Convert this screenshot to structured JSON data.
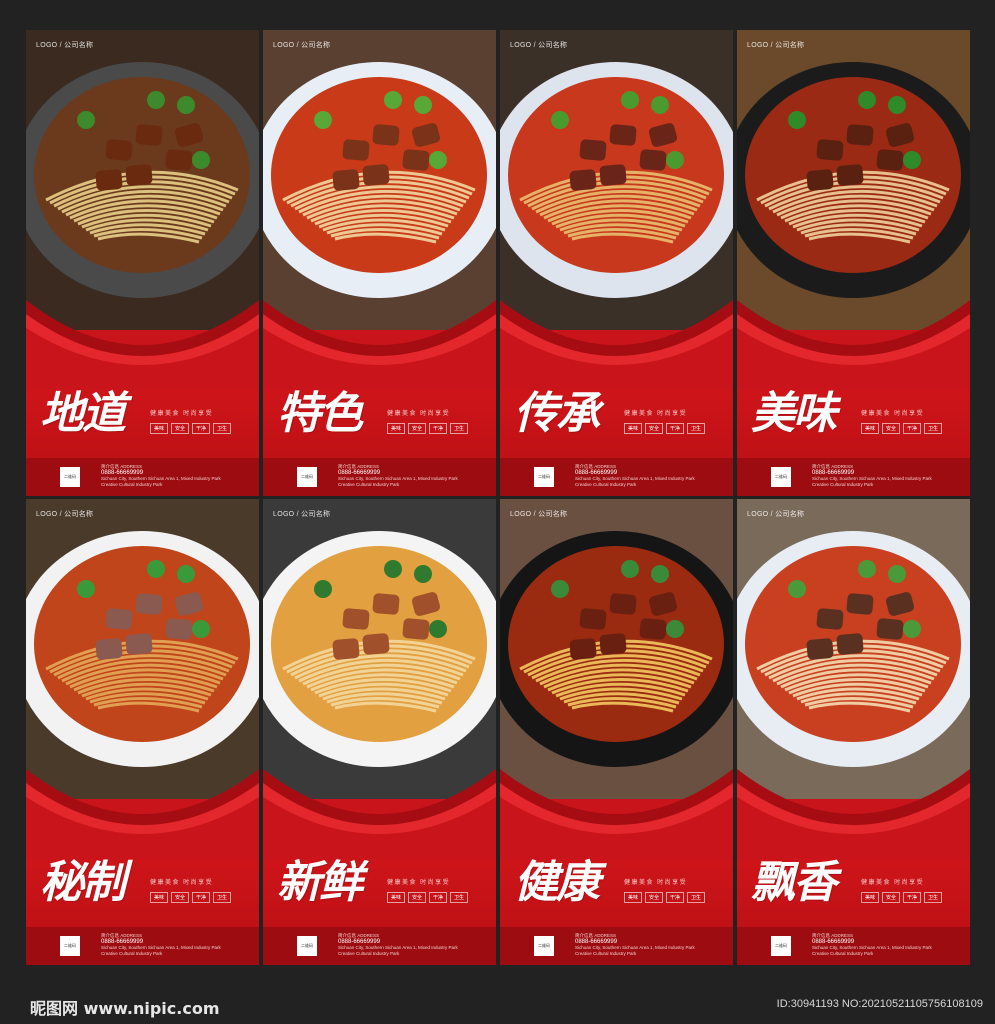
{
  "logo_text": "LOGO / 公司名称",
  "slogan": "健康美食 时尚享受",
  "tags": [
    "美味",
    "安全",
    "干净",
    "卫生"
  ],
  "qr_label": "二维码",
  "address_lines": [
    "简介信息 ADDRESS",
    "0888-66669999",
    "Sichuan City, Southern Sichuan Area 1, Mixed Industry Park",
    "Creative Cultural Industry Park"
  ],
  "panels": [
    {
      "title": "地道"
    },
    {
      "title": "特色"
    },
    {
      "title": "传承"
    },
    {
      "title": "美味"
    },
    {
      "title": "秘制"
    },
    {
      "title": "新鲜"
    },
    {
      "title": "健康"
    },
    {
      "title": "飘香"
    }
  ],
  "footer": {
    "site": "昵图网 www.nipic.com",
    "id_text": "ID:30941193 NO:20210521105756108109"
  },
  "colors": {
    "brand_red": "#c8141a",
    "dark_red": "#9c0c10",
    "background": "#222223"
  }
}
